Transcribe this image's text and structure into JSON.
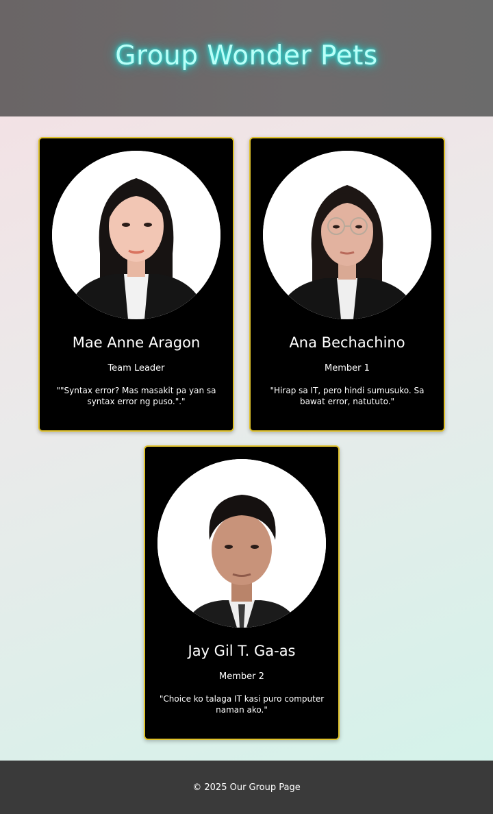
{
  "header": {
    "title": "Group Wonder Pets"
  },
  "members": [
    {
      "name": "Mae Anne Aragon",
      "role": "Team Leader",
      "quote": "\"\"Syntax error? Mas masakit pa yan sa syntax error ng puso.\".\""
    },
    {
      "name": "Ana Bechachino",
      "role": "Member 1",
      "quote": "\"Hirap sa IT, pero hindi sumusuko. Sa bawat error, natututo.\""
    },
    {
      "name": "Jay Gil T. Ga-as",
      "role": "Member 2",
      "quote": "\"Choice ko talaga IT kasi puro computer naman ako.\""
    }
  ],
  "footer": {
    "text": "© 2025 Our Group Page"
  },
  "colors": {
    "card_border": "#e0c22b",
    "title_glow": "#36e6e0",
    "footer_bg": "#3a3a3a"
  }
}
